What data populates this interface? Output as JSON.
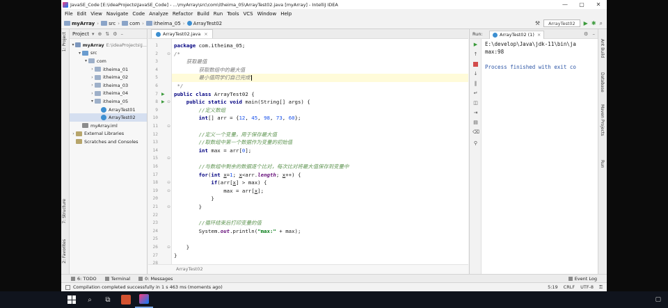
{
  "window": {
    "title": "JavaSE_Code [E:\\ideaProjects\\JavaSE_Code] - ...\\myArray\\src\\com\\itheima_05\\ArrayTest02.java [myArray] - IntelliJ IDEA",
    "controls": [
      "—",
      "▢",
      "✕"
    ]
  },
  "menu": [
    "File",
    "Edit",
    "View",
    "Navigate",
    "Code",
    "Analyze",
    "Refactor",
    "Build",
    "Run",
    "Tools",
    "VCS",
    "Window",
    "Help"
  ],
  "breadcrumb": [
    "myArray",
    "src",
    "com",
    "itheima_05",
    "ArrayTest02"
  ],
  "run_config": "ArrayTest02",
  "left_strip": {
    "project": "1: Project",
    "structure": "7: Structure",
    "favorites": "2: Favorites"
  },
  "project_panel": {
    "label": "Project",
    "tree": [
      {
        "text": "myArray",
        "extra": "E:\\ideaProjects\\J...",
        "indent": 0,
        "arrow": "▾",
        "icon": "module"
      },
      {
        "text": "src",
        "extra": "",
        "indent": 1,
        "arrow": "▾",
        "icon": "src"
      },
      {
        "text": "com",
        "extra": "",
        "indent": 2,
        "arrow": "▾",
        "icon": "package"
      },
      {
        "text": "itheima_01",
        "extra": "",
        "indent": 3,
        "arrow": "›",
        "icon": "package"
      },
      {
        "text": "itheima_02",
        "extra": "",
        "indent": 3,
        "arrow": "›",
        "icon": "package"
      },
      {
        "text": "itheima_03",
        "extra": "",
        "indent": 3,
        "arrow": "›",
        "icon": "package"
      },
      {
        "text": "itheima_04",
        "extra": "",
        "indent": 3,
        "arrow": "›",
        "icon": "package"
      },
      {
        "text": "itheima_05",
        "extra": "",
        "indent": 3,
        "arrow": "▾",
        "icon": "package"
      },
      {
        "text": "ArrayTest01",
        "extra": "",
        "indent": 4,
        "arrow": "",
        "icon": "class"
      },
      {
        "text": "ArrayTest02",
        "extra": "",
        "indent": 4,
        "arrow": "",
        "icon": "class",
        "selected": true
      },
      {
        "text": "myArray.iml",
        "extra": "",
        "indent": 1,
        "arrow": "",
        "icon": "iml"
      },
      {
        "text": "External Libraries",
        "extra": "",
        "indent": 0,
        "arrow": "›",
        "icon": "lib"
      },
      {
        "text": "Scratches and Consoles",
        "extra": "",
        "indent": 0,
        "arrow": "",
        "icon": "lib"
      }
    ]
  },
  "editor": {
    "tab": "ArrayTest02.java",
    "footer_breadcrumb": "ArrayTest02",
    "lines": [
      [
        {
          "t": "package ",
          "c": "kw"
        },
        {
          "t": "com.itheima_05;",
          "c": ""
        }
      ],
      [
        {
          "t": "/*",
          "c": "cm"
        }
      ],
      [
        {
          "t": "    获取最值",
          "c": "cm"
        }
      ],
      [
        {
          "t": "        获取数组中的最大值",
          "c": "cm"
        }
      ],
      [
        {
          "t": "        最小值同学们自己完成",
          "c": "cm"
        }
      ],
      [
        {
          "t": " */",
          "c": "cm"
        }
      ],
      [
        {
          "t": "public class ",
          "c": "kw"
        },
        {
          "t": "ArrayTest02 {",
          "c": ""
        }
      ],
      [
        {
          "t": "    public static void ",
          "c": "kw"
        },
        {
          "t": "main(String[] args) {",
          "c": ""
        }
      ],
      [
        {
          "t": "        //定义数组",
          "c": "cmg"
        }
      ],
      [
        {
          "t": "        int",
          "c": "kw"
        },
        {
          "t": "[] arr = {",
          "c": ""
        },
        {
          "t": "12",
          "c": "num"
        },
        {
          "t": ", ",
          "c": ""
        },
        {
          "t": "45",
          "c": "num"
        },
        {
          "t": ", ",
          "c": ""
        },
        {
          "t": "98",
          "c": "num"
        },
        {
          "t": ", ",
          "c": ""
        },
        {
          "t": "73",
          "c": "num"
        },
        {
          "t": ", ",
          "c": ""
        },
        {
          "t": "60",
          "c": "num"
        },
        {
          "t": "};",
          "c": ""
        }
      ],
      [
        {
          "t": "",
          "c": ""
        }
      ],
      [
        {
          "t": "        //定义一个变量，用于保存最大值",
          "c": "cmg"
        }
      ],
      [
        {
          "t": "        //取数组中第一个数据作为变量的初始值",
          "c": "cmg"
        }
      ],
      [
        {
          "t": "        int ",
          "c": "kw"
        },
        {
          "t": "max = arr[",
          "c": ""
        },
        {
          "t": "0",
          "c": "num"
        },
        {
          "t": "];",
          "c": ""
        }
      ],
      [
        {
          "t": "",
          "c": ""
        }
      ],
      [
        {
          "t": "        //与数组中剩余的数据逐个比对，每次比对将最大值保存到变量中",
          "c": "cmg"
        }
      ],
      [
        {
          "t": "        for",
          "c": "kw"
        },
        {
          "t": "(",
          "c": ""
        },
        {
          "t": "int ",
          "c": "kw"
        },
        {
          "t": "x",
          "c": "var"
        },
        {
          "t": "=",
          "c": ""
        },
        {
          "t": "1",
          "c": "num"
        },
        {
          "t": "; ",
          "c": ""
        },
        {
          "t": "x",
          "c": "var"
        },
        {
          "t": "<arr.",
          "c": ""
        },
        {
          "t": "length",
          "c": "fld"
        },
        {
          "t": "; ",
          "c": ""
        },
        {
          "t": "x",
          "c": "var"
        },
        {
          "t": "++) {",
          "c": ""
        }
      ],
      [
        {
          "t": "            if",
          "c": "kw"
        },
        {
          "t": "(arr[",
          "c": ""
        },
        {
          "t": "x",
          "c": "var"
        },
        {
          "t": "] > max) {",
          "c": ""
        }
      ],
      [
        {
          "t": "                max = arr[",
          "c": ""
        },
        {
          "t": "x",
          "c": "var"
        },
        {
          "t": "];",
          "c": ""
        }
      ],
      [
        {
          "t": "            }",
          "c": ""
        }
      ],
      [
        {
          "t": "        }",
          "c": ""
        }
      ],
      [
        {
          "t": "",
          "c": ""
        }
      ],
      [
        {
          "t": "        //循环结束后打印变量的值",
          "c": "cmg"
        }
      ],
      [
        {
          "t": "        System.",
          "c": ""
        },
        {
          "t": "out",
          "c": "fld"
        },
        {
          "t": ".println(",
          "c": ""
        },
        {
          "t": "\"max:\"",
          "c": "str"
        },
        {
          "t": " + max);",
          "c": ""
        }
      ],
      [
        {
          "t": "",
          "c": ""
        }
      ],
      [
        {
          "t": "    }",
          "c": ""
        }
      ],
      [
        {
          "t": "}",
          "c": ""
        }
      ],
      [
        {
          "t": "",
          "c": ""
        }
      ]
    ]
  },
  "run_panel": {
    "label": "Run:",
    "tab": "ArrayTest02 (1)",
    "output": [
      "E:\\develop\\Java\\jdk-11\\bin\\ja",
      "max:98",
      "",
      "Process finished with exit co"
    ]
  },
  "right_strip": [
    "Ant Build",
    "Database",
    "Maven Projects",
    "Run"
  ],
  "bottom_tools": [
    "6: TODO",
    "Terminal",
    "0: Messages"
  ],
  "event_log": "Event Log",
  "status": {
    "message": "Compilation completed successfully in 1 s 463 ms (moments ago)",
    "position": "5:19",
    "line_sep": "CRLF",
    "encoding": "UTF-8"
  },
  "taskbar": {
    "search_icon": "search-icon",
    "taskview_icon": "taskview-icon"
  }
}
